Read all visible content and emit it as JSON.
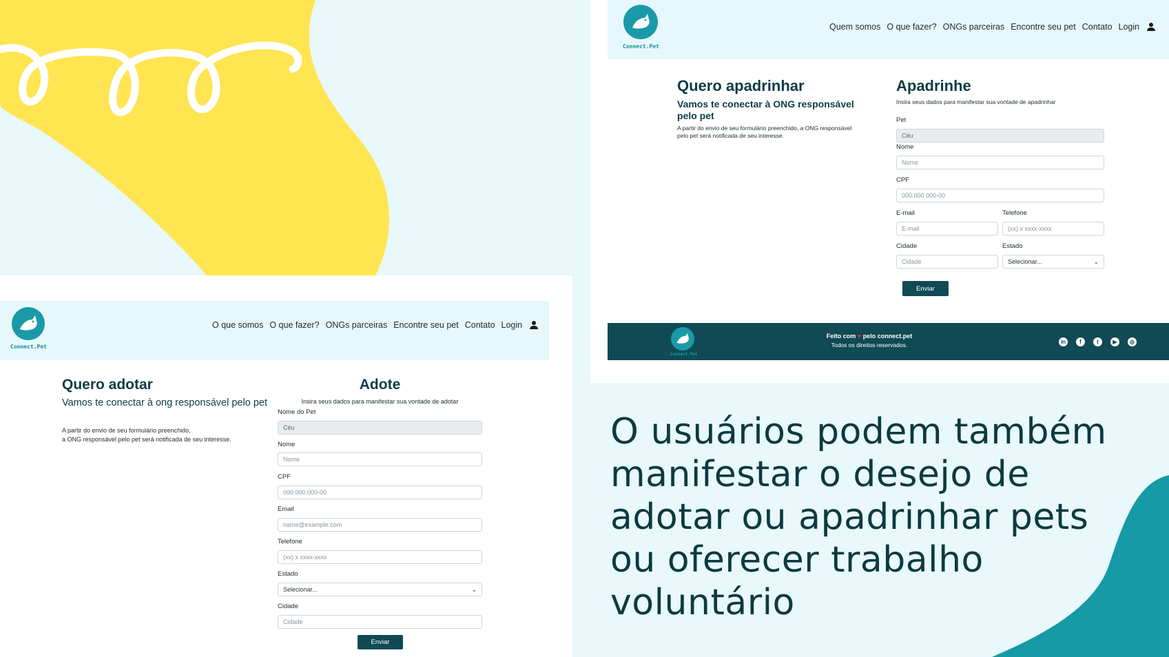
{
  "brand": {
    "name": "Connect.Pet"
  },
  "adopt_page": {
    "nav": [
      "O que somos",
      "O que fazer?",
      "ONGs parceiras",
      "Encontre seu pet",
      "Contato",
      "Login"
    ],
    "left": {
      "title": "Quero adotar",
      "subtitle": "Vamos te conectar à ong responsável pelo pet",
      "text_line1": "A partir do envio de seu formulário preenchido,",
      "text_line2": "a ONG responsável pelo pet será notificada de seu interesse."
    },
    "form": {
      "title": "Adote",
      "description": "Insira seus dados para manifestar sua vontade de adotar",
      "pet_label": "Nome do Pet",
      "pet_value": "Céu",
      "name_label": "Nome",
      "name_placeholder": "Nome",
      "cpf_label": "CPF",
      "cpf_placeholder": "000.000.000-00",
      "email_label": "Email",
      "email_placeholder": "name@example.com",
      "phone_label": "Telefone",
      "phone_placeholder": "(xx) x xxxx-xxxx",
      "state_label": "Estado",
      "state_value": "Selecionar...",
      "city_label": "Cidade",
      "city_placeholder": "Cidade",
      "submit": "Enviar"
    }
  },
  "sponsor_page": {
    "nav": [
      "Quem somos",
      "O que fazer?",
      "ONGs parceiras",
      "Encontre seu pet",
      "Contato",
      "Login"
    ],
    "left": {
      "title": "Quero apadrinhar",
      "subtitle": "Vamos te conectar à ONG responsável pelo pet",
      "text_line1": "A partir do envio de seu formulário preenchido, a ONG responsável",
      "text_line2": "pelo pet será notificada de seu interesse."
    },
    "form": {
      "title": "Apadrinhe",
      "description": "Insira seus dados para manifestar sua vontade de apadrinhar",
      "pet_label": "Pet",
      "pet_value": "Céu",
      "name_label": "Nome",
      "name_placeholder": "Nome",
      "cpf_label": "CPF",
      "cpf_placeholder": "000.000.000-00",
      "email_label": "E-mail",
      "email_placeholder": "E-mail",
      "phone_label": "Telefone",
      "phone_placeholder": "(xx) x xxxx-xxxx",
      "city_label": "Cidade",
      "city_placeholder": "Cidade",
      "state_label": "Estado",
      "state_value": "Selecionar...",
      "submit": "Enviar"
    },
    "footer": {
      "made_with_prefix": "Feito com",
      "made_with_suffix": "pelo connect.pet",
      "rights": "Todos os direitos reservados.",
      "social": [
        "linkedin-icon",
        "facebook-icon",
        "twitter-icon",
        "youtube-icon",
        "instagram-icon"
      ]
    }
  },
  "caption": "O usuários podem também\n manifestar o desejo de\nadotar ou apadrinhar pets\nou oferecer trabalho\nvoluntário",
  "colors": {
    "teal": "#1a9aa8",
    "dark_teal": "#0f4a55",
    "yellow": "#ffe552",
    "light_bg": "#e8f8fb"
  }
}
